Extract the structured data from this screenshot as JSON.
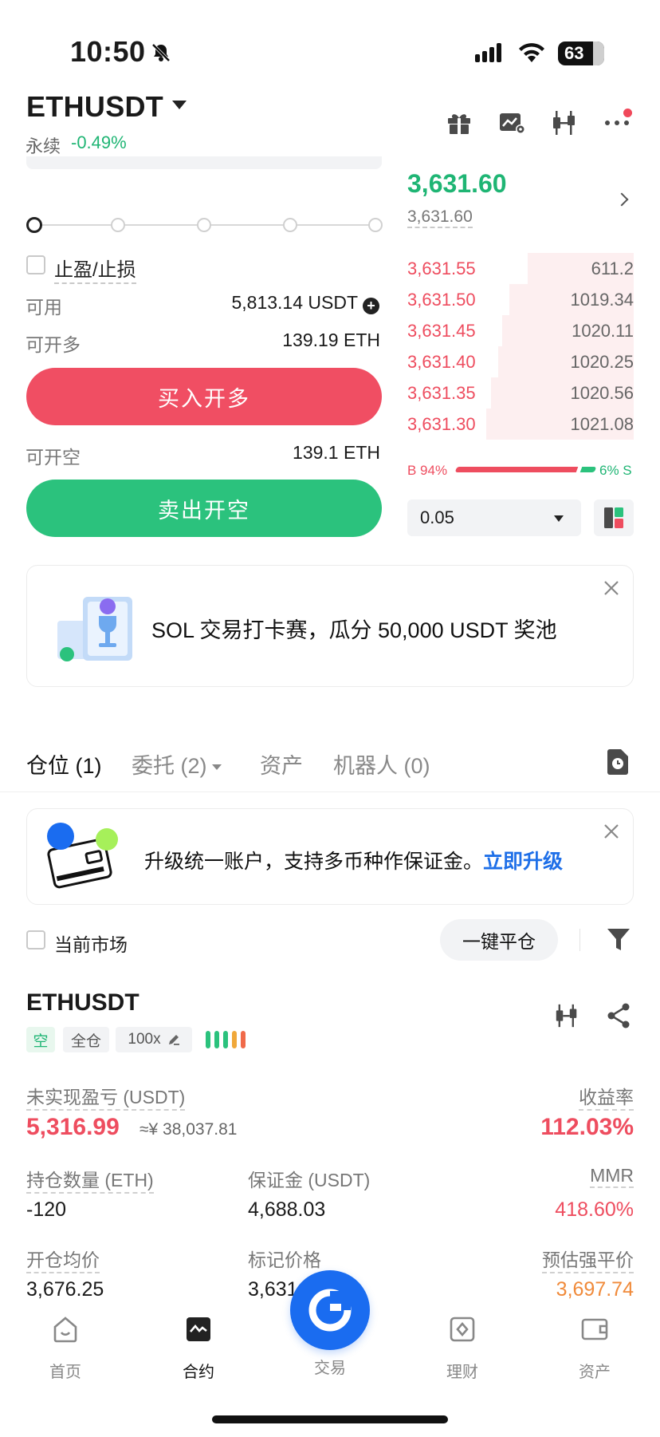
{
  "status_bar": {
    "time": "10:50",
    "battery": "63"
  },
  "header": {
    "pair": "ETHUSDT",
    "contract_type": "永续",
    "change": "-0.49%",
    "icons": [
      "gift-icon",
      "chart-settings-icon",
      "candlestick-icon",
      "more-icon"
    ]
  },
  "order_form": {
    "tp_sl_label": "止盈/止损",
    "available_label": "可用",
    "available_value": "5,813.14 USDT",
    "can_open_long_label": "可开多",
    "can_open_long_value": "139.19 ETH",
    "buy_button": "买入开多",
    "can_open_short_label": "可开空",
    "can_open_short_value": "139.1 ETH",
    "sell_button": "卖出开空"
  },
  "order_book": {
    "last_price": "3,631.60",
    "mark_price": "3,631.60",
    "asks": [
      {
        "price": "3,631.55",
        "qty": "611.2",
        "depth": 0.47
      },
      {
        "price": "3,631.50",
        "qty": "1019.34",
        "depth": 0.55
      },
      {
        "price": "3,631.45",
        "qty": "1020.11",
        "depth": 0.58
      },
      {
        "price": "3,631.40",
        "qty": "1020.25",
        "depth": 0.6
      },
      {
        "price": "3,631.35",
        "qty": "1020.56",
        "depth": 0.63
      },
      {
        "price": "3,631.30",
        "qty": "1021.08",
        "depth": 0.65
      }
    ],
    "buy_ratio": "B 94%",
    "sell_ratio": "6% S",
    "precision": "0.05"
  },
  "banner": {
    "text": "SOL 交易打卡赛，瓜分 50,000 USDT 奖池"
  },
  "tabs": [
    {
      "label": "仓位 (1)"
    },
    {
      "label": "委托 (2)"
    },
    {
      "label": "资产"
    },
    {
      "label": "机器人 (0)"
    }
  ],
  "upgrade": {
    "text": "升级统一账户，支持多币种作保证金。",
    "link": "立即升级"
  },
  "filters": {
    "current_market": "当前市场",
    "close_all": "一键平仓"
  },
  "position": {
    "pair": "ETHUSDT",
    "side": "空",
    "margin_mode": "全仓",
    "leverage": "100x",
    "unrealized_pnl_label": "未实现盈亏 (USDT)",
    "unrealized_pnl": "5,316.99",
    "unrealized_pnl_cny": "≈¥ 38,037.81",
    "roe_label": "收益率",
    "roe": "112.03%",
    "size_label": "持仓数量 (ETH)",
    "size": "-120",
    "margin_label": "保证金 (USDT)",
    "margin": "4,688.03",
    "mmr_label": "MMR",
    "mmr": "418.60%",
    "entry_label": "开仓均价",
    "entry": "3,676.25",
    "mark_label": "标记价格",
    "mark": "3,631",
    "liq_label": "预估强平价",
    "liq": "3,697.74",
    "risk_colors": [
      "#2bc27d",
      "#2bc27d",
      "#2bc27d",
      "#f0a83a",
      "#f06a4a"
    ]
  },
  "bottom_nav": [
    {
      "label": "首页"
    },
    {
      "label": "合约"
    },
    {
      "label": "交易"
    },
    {
      "label": "理财"
    },
    {
      "label": "资产"
    }
  ]
}
